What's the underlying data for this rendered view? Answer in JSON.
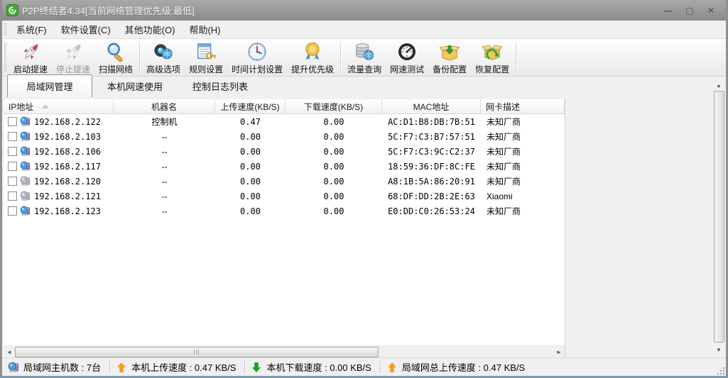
{
  "window": {
    "title": "P2P终结者4.34[当前网络管理优先级:最低]",
    "controls": {
      "minimize": "—",
      "maximize": "▢",
      "close": "✕"
    }
  },
  "menu": {
    "items": [
      {
        "key": "system",
        "label": "系统(F)"
      },
      {
        "key": "settings",
        "label": "软件设置(C)"
      },
      {
        "key": "other",
        "label": "其他功能(O)"
      },
      {
        "key": "help",
        "label": "帮助(H)"
      }
    ]
  },
  "toolbar": {
    "buttons": [
      {
        "key": "start-boost",
        "label": "启动提速",
        "icon": "rocket-start-icon",
        "disabled": false,
        "group_end": false
      },
      {
        "key": "stop-boost",
        "label": "停止提速",
        "icon": "rocket-stop-icon",
        "disabled": true,
        "group_end": false
      },
      {
        "key": "scan-network",
        "label": "扫描网络",
        "icon": "scan-network-icon",
        "disabled": false,
        "group_end": true
      },
      {
        "key": "advanced",
        "label": "高级选项",
        "icon": "advanced-options-icon",
        "disabled": false,
        "group_end": false
      },
      {
        "key": "rules",
        "label": "规则设置",
        "icon": "rules-settings-icon",
        "disabled": false,
        "group_end": false
      },
      {
        "key": "schedule",
        "label": "时间计划设置",
        "icon": "schedule-clock-icon",
        "disabled": false,
        "group_end": false
      },
      {
        "key": "priority",
        "label": "提升优先级",
        "icon": "priority-medal-icon",
        "disabled": false,
        "group_end": true
      },
      {
        "key": "traffic-query",
        "label": "流量查询",
        "icon": "traffic-query-icon",
        "disabled": false,
        "group_end": false
      },
      {
        "key": "speed-test",
        "label": "网速测试",
        "icon": "speed-test-icon",
        "disabled": false,
        "group_end": false
      },
      {
        "key": "backup-config",
        "label": "备份配置",
        "icon": "backup-config-icon",
        "disabled": false,
        "group_end": false
      },
      {
        "key": "restore-config",
        "label": "恢复配置",
        "icon": "restore-config-icon",
        "disabled": false,
        "group_end": true
      }
    ]
  },
  "tabs": [
    {
      "key": "lan-manage",
      "label": "局域网管理",
      "active": true
    },
    {
      "key": "local-speed",
      "label": "本机网速使用",
      "active": false
    },
    {
      "key": "control-log",
      "label": "控制日志列表",
      "active": false
    }
  ],
  "table": {
    "columns": [
      "IP地址",
      "机器名",
      "上传速度(KB/S)",
      "下载速度(KB/S)",
      "MAC地址",
      "网卡描述"
    ],
    "rows": [
      {
        "ip": "192.168.2.122",
        "name": "控制机",
        "up": "0.47",
        "down": "0.00",
        "mac": "AC:D1:B8:DB:7B:51",
        "vendor": "未知厂商",
        "icon_dim": false
      },
      {
        "ip": "192.168.2.103",
        "name": "--",
        "up": "0.00",
        "down": "0.00",
        "mac": "5C:F7:C3:B7:57:51",
        "vendor": "未知厂商",
        "icon_dim": false
      },
      {
        "ip": "192.168.2.106",
        "name": "--",
        "up": "0.00",
        "down": "0.00",
        "mac": "5C:F7:C3:9C:C2:37",
        "vendor": "未知厂商",
        "icon_dim": false
      },
      {
        "ip": "192.168.2.117",
        "name": "--",
        "up": "0.00",
        "down": "0.00",
        "mac": "18:59:36:DF:8C:FE",
        "vendor": "未知厂商",
        "icon_dim": false
      },
      {
        "ip": "192.168.2.120",
        "name": "--",
        "up": "0.00",
        "down": "0.00",
        "mac": "A8:1B:5A:86:20:91",
        "vendor": "未知厂商",
        "icon_dim": true
      },
      {
        "ip": "192.168.2.121",
        "name": "--",
        "up": "0.00",
        "down": "0.00",
        "mac": "68:DF:DD:2B:2E:63",
        "vendor": "Xiaomi",
        "icon_dim": true
      },
      {
        "ip": "192.168.2.123",
        "name": "--",
        "up": "0.00",
        "down": "0.00",
        "mac": "E0:DD:C0:26:53:24",
        "vendor": "未知厂商",
        "icon_dim": false
      }
    ]
  },
  "statusbar": {
    "segments": [
      {
        "key": "host-count",
        "icon": "computer-icon",
        "text": "局域网主机数 : 7台"
      },
      {
        "key": "up-speed",
        "icon": "upload-arrow-icon",
        "text": "本机上传速度 : 0.47 KB/S"
      },
      {
        "key": "down-speed",
        "icon": "download-arrow-icon",
        "text": "本机下载速度 : 0.00 KB/S"
      },
      {
        "key": "lan-up",
        "icon": "upload-arrow-icon",
        "text": "局域网总上传速度 : 0.47 KB/S"
      }
    ]
  },
  "colors": {
    "titlebar": "#8a8a8a",
    "upload_arrow": "#f59a23",
    "download_arrow": "#1ca21c",
    "app_icon_green": "#44a832",
    "computer_icon_blue": "#4aa0e6"
  }
}
